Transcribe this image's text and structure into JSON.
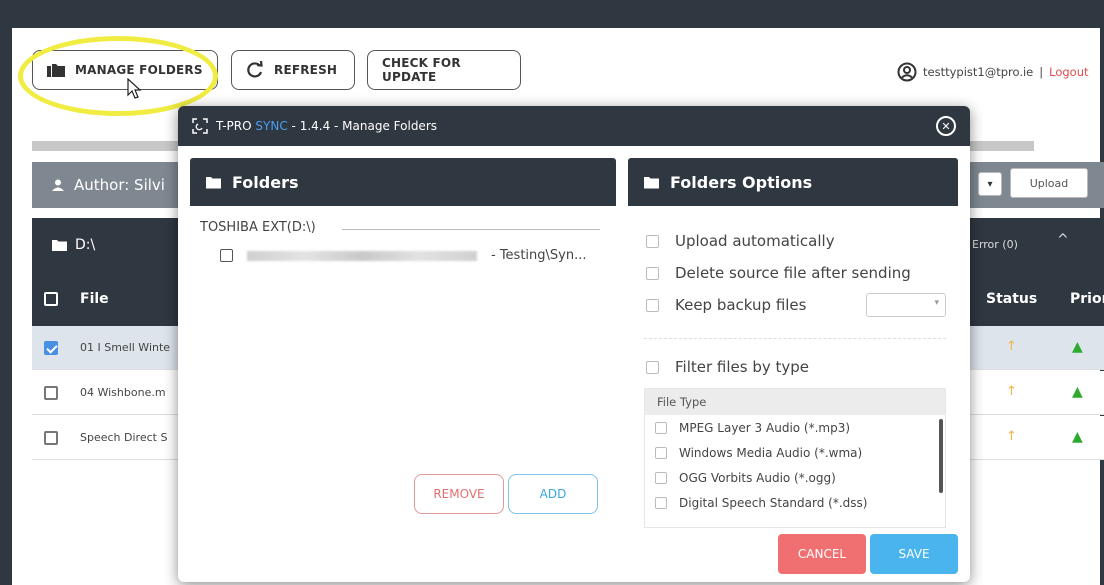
{
  "toolbar": {
    "manage_folders": "MANAGE FOLDERS",
    "refresh": "REFRESH",
    "check_update": "CHECK FOR UPDATE"
  },
  "user": {
    "email": "testtypist1@tpro.ie",
    "separator": "|",
    "logout": "Logout"
  },
  "author_bar": {
    "label": "Author: Silvi",
    "upload": "Upload"
  },
  "folder_bar": {
    "path": "D:\\",
    "error": "Error (0)"
  },
  "table": {
    "headers": {
      "file": "File",
      "status": "Status",
      "priority": "Prior"
    },
    "rows": [
      {
        "file": "01 I Smell Winte",
        "checked": true
      },
      {
        "file": "04 Wishbone.m",
        "checked": false
      },
      {
        "file": "Speech Direct S",
        "checked": false
      }
    ]
  },
  "modal": {
    "title_prefix": "T-PRO",
    "title_sync": "SYNC",
    "title_rest": "- 1.4.4 - Manage Folders",
    "folders_pane": {
      "title": "Folders",
      "drive": "TOSHIBA EXT(D:\\)",
      "folder_suffix": "- Testing\\Syn...",
      "remove": "REMOVE",
      "add": "ADD"
    },
    "options_pane": {
      "title": "Folders Options",
      "upload_auto": "Upload automatically",
      "delete_source": "Delete source file after sending",
      "keep_backup": "Keep backup files",
      "filter_by_type": "Filter files by type",
      "file_type_header": "File Type",
      "file_types": [
        "MPEG Layer 3 Audio (*.mp3)",
        "Windows Media Audio (*.wma)",
        "OGG Vorbits Audio (*.ogg)",
        "Digital Speech Standard (*.dss)"
      ]
    },
    "cancel": "CANCEL",
    "save": "SAVE"
  },
  "colors": {
    "dark": "#2f3740",
    "accent_blue": "#4a9ef0",
    "cancel_red": "#f07072",
    "save_blue": "#4ab4ee",
    "highlight": "#f0ec42",
    "logout_red": "#e24c4c"
  }
}
